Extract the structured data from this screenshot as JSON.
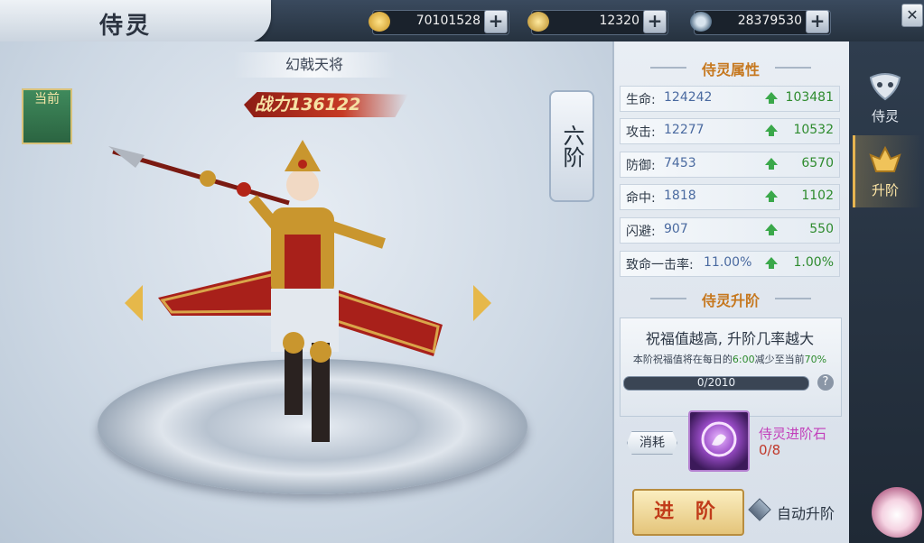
{
  "header": {
    "title": "侍灵",
    "resources": [
      {
        "icon": "gold-ingot-icon",
        "value": "70101528"
      },
      {
        "icon": "bound-gold-icon",
        "value": "12320"
      },
      {
        "icon": "coin-icon",
        "value": "28379530"
      }
    ]
  },
  "stage": {
    "spirit_name": "幻戟天将",
    "power": "战力136122",
    "current_badge": "当前",
    "grade": "六阶"
  },
  "attributes": {
    "title": "侍灵属性",
    "rows": [
      {
        "label": "生命:",
        "value": "124242",
        "increase": "103481"
      },
      {
        "label": "攻击:",
        "value": "12277",
        "increase": "10532"
      },
      {
        "label": "防御:",
        "value": "7453",
        "increase": "6570"
      },
      {
        "label": "命中:",
        "value": "1818",
        "increase": "1102"
      },
      {
        "label": "闪避:",
        "value": "907",
        "increase": "550"
      },
      {
        "label": "致命一击率:",
        "value": "11.00%",
        "increase": "1.00%"
      }
    ]
  },
  "advance": {
    "title": "侍灵升阶",
    "tip": "祝福值越高, 升阶几率越大",
    "note_prefix": "本阶祝福值将在每日的",
    "note_time": "6:00",
    "note_middle": "减少至当前",
    "note_percent": "70%",
    "progress_text": "0/2010",
    "progress_fraction": 0.0,
    "help": "?",
    "consume_label": "消耗",
    "item_name": "侍灵进阶石",
    "item_count": "0/8",
    "advance_button": "进 阶",
    "auto_label": "自动升阶"
  },
  "side_tabs": [
    {
      "label": "侍灵",
      "icon": "spirit-mask-icon",
      "active": false
    },
    {
      "label": "升阶",
      "icon": "advance-crest-icon",
      "active": true
    }
  ],
  "colors": {
    "accent_gold": "#c6781f",
    "increase_green": "#2e8b2e",
    "stat_blue": "#4a6aa0",
    "item_purple": "#c23fbb"
  }
}
